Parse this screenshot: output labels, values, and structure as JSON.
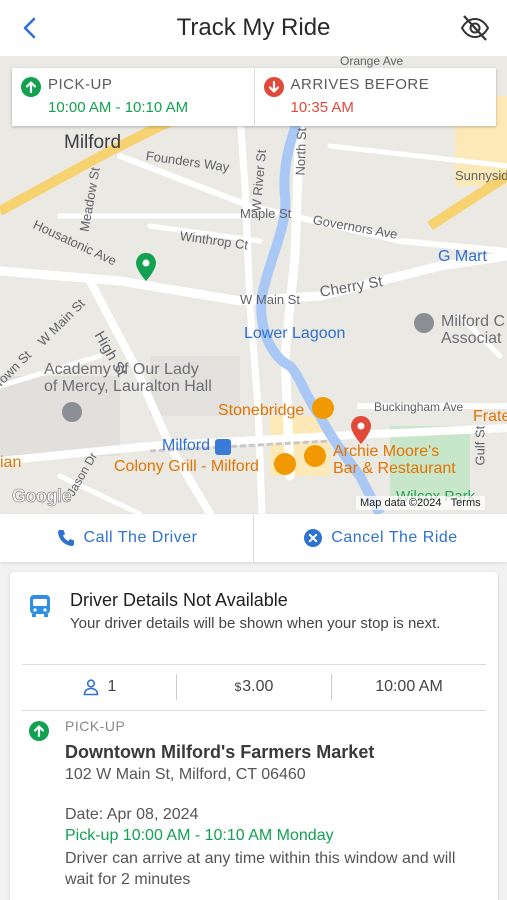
{
  "header": {
    "title": "Track My Ride",
    "back_icon": "chevron-left-icon",
    "hide_icon": "eye-off-icon"
  },
  "trip_summary": {
    "pickup_caption": "PICK-UP",
    "pickup_window": "10:00 AM - 10:10 AM",
    "arrive_caption": "ARRIVES BEFORE",
    "arrive_time": "10:35 AM"
  },
  "map": {
    "labels": {
      "milford": "Milford",
      "founders_way": "Founders Way",
      "sunnyside": "Sunnyside",
      "meadow_st": "Meadow St",
      "w_river_st": "W River St",
      "north_st": "North St",
      "maple_st": "Maple St",
      "governors_ave": "Governors Ave",
      "housatonic_ave": "Housatonic Ave",
      "winthrop_ct": "Winthrop Ct",
      "g_mart": "G Mart",
      "w_main_st_right": "W Main St",
      "cherry_st": "Cherry St",
      "high_st": "High St",
      "w_main_st_left": "W Main St",
      "lower_lagoon": "Lower Lagoon",
      "milford_assoc_1": "Milford C",
      "milford_assoc_2": "Associat",
      "academy_1": "Academy of Our Lady",
      "academy_2": "of Mercy, Lauralton Hall",
      "town_st": "Town St",
      "stonebridge": "Stonebridge",
      "buckingham_ave": "Buckingham Ave",
      "frate": "Frate",
      "milford_station": "Milford",
      "archie_1": "Archie Moore's",
      "archie_2": "Bar & Restaurant",
      "gulf_st": "Gulf St",
      "ian": "ian",
      "colony_grill": "Colony Grill - Milford",
      "jason_dr": "Jason Dr",
      "wilcox_park": "Wilcox Park",
      "orange_ave": "Orange Ave"
    },
    "google_logo": "Google",
    "attribution": "Map data ©2024",
    "terms": "Terms"
  },
  "actions": {
    "call_label": "Call The Driver",
    "cancel_label": "Cancel The Ride"
  },
  "driver": {
    "title": "Driver Details Not Available",
    "subtitle": "Your driver details will be shown when your stop is next."
  },
  "stats": {
    "passengers": "1",
    "fare_symbol": "$",
    "fare_amount": "3.00",
    "time": "10:00 AM"
  },
  "stop": {
    "caption": "PICK-UP",
    "name": "Downtown Milford's Farmers Market",
    "address": "102 W Main St, Milford, CT 06460",
    "date": "Date: Apr 08, 2024",
    "window": "Pick-up 10:00 AM - 10:10 AM Monday",
    "note": "Driver can arrive at any time within this window and will wait for 2 minutes"
  },
  "colors": {
    "accent_blue": "#2f72d0",
    "pickup_green": "#12a150",
    "arrive_red": "#e04a3b"
  }
}
